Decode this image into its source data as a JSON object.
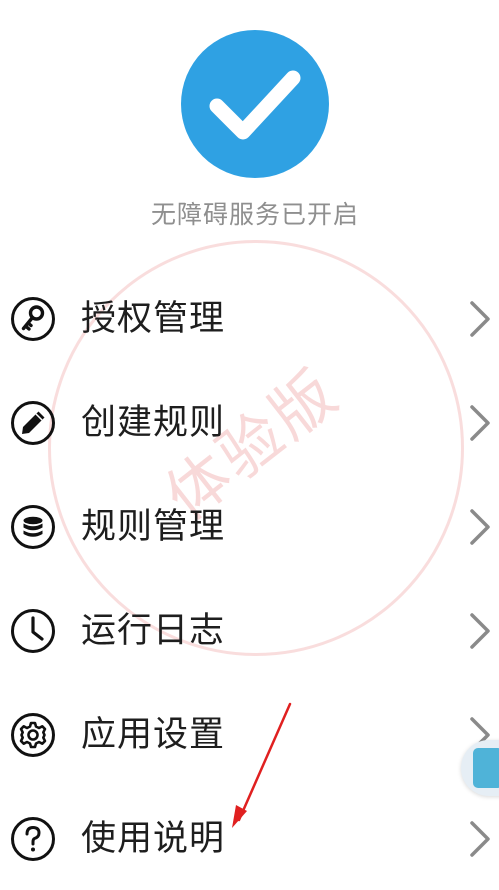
{
  "status": {
    "text": "无障碍服务已开启",
    "icon": "checkmark-icon",
    "color": "#2fa1e3"
  },
  "watermark": {
    "text": "体验版"
  },
  "menu": {
    "items": [
      {
        "label": "授权管理",
        "icon": "key-icon"
      },
      {
        "label": "创建规则",
        "icon": "pencil-icon"
      },
      {
        "label": "规则管理",
        "icon": "database-icon"
      },
      {
        "label": "运行日志",
        "icon": "clock-icon"
      },
      {
        "label": "应用设置",
        "icon": "gear-icon"
      },
      {
        "label": "使用说明",
        "icon": "help-icon"
      }
    ]
  },
  "colors": {
    "text": "#1e1e1e",
    "chevron": "#8a8a8a",
    "annotation_arrow": "#e02020"
  }
}
